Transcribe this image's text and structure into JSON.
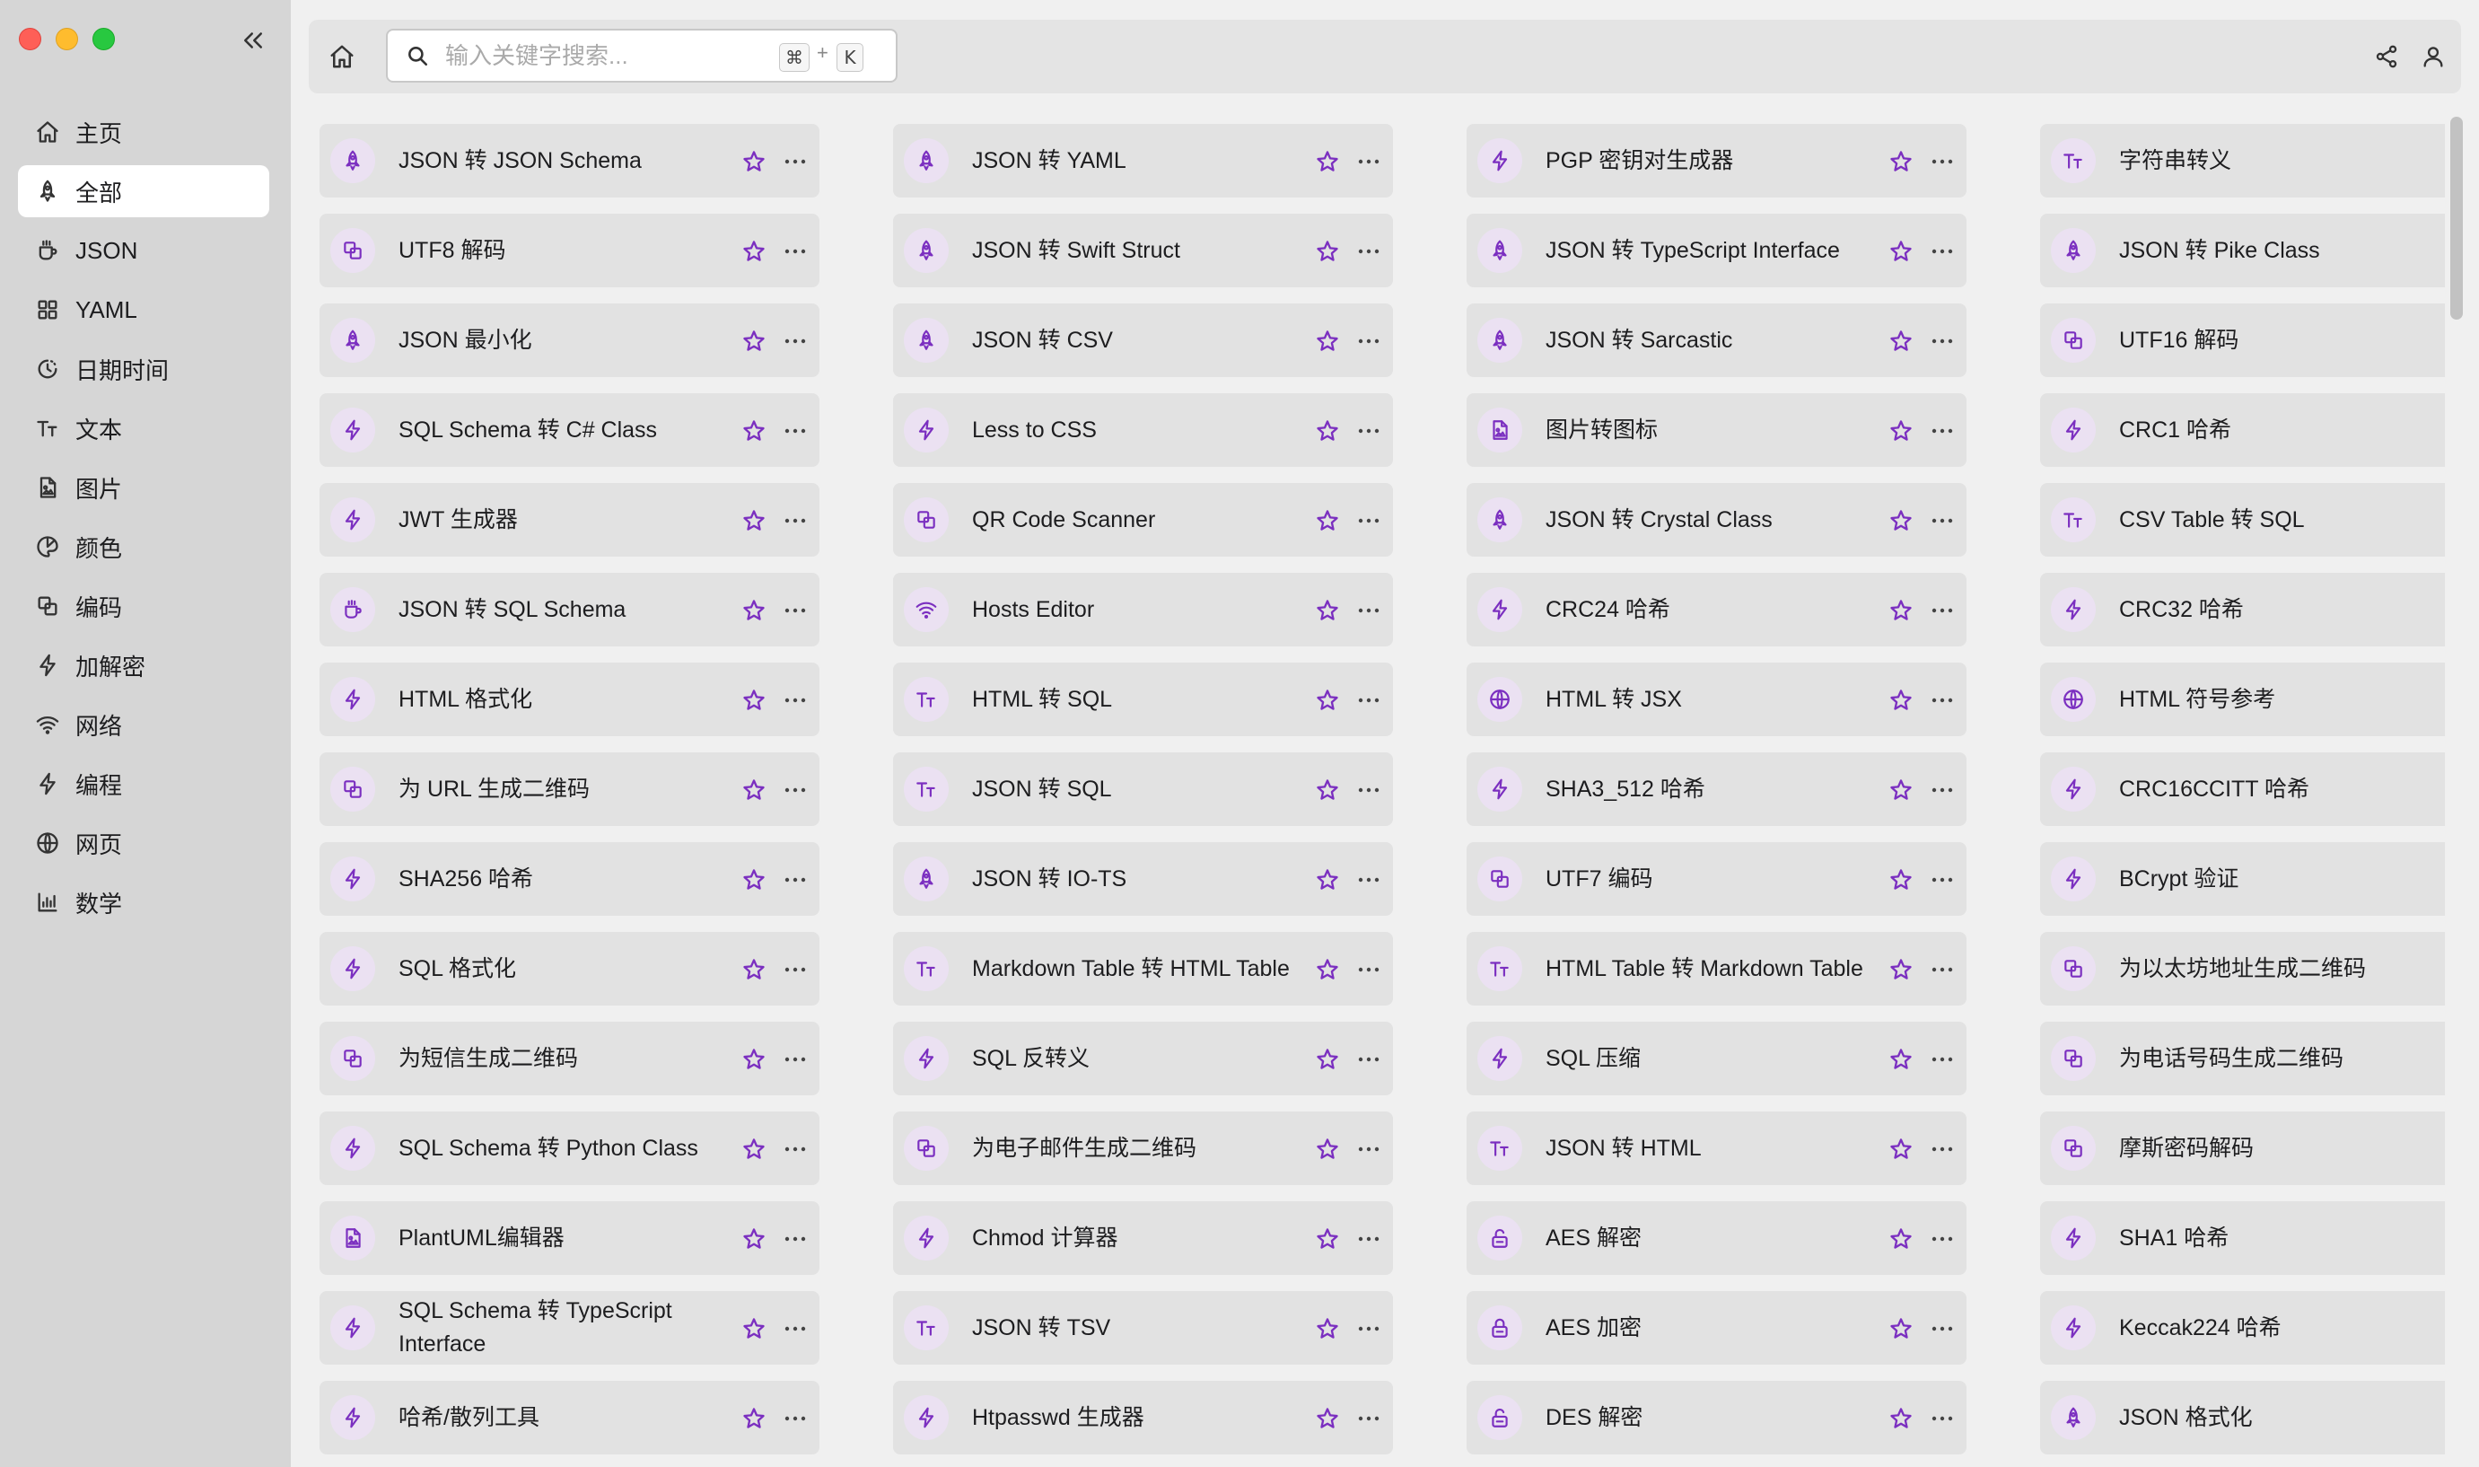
{
  "sidebar": {
    "items": [
      {
        "label": "主页",
        "icon": "home-icon",
        "active": false
      },
      {
        "label": "全部",
        "icon": "rocket-icon",
        "active": true
      },
      {
        "label": "JSON",
        "icon": "mug-icon",
        "active": false
      },
      {
        "label": "YAML",
        "icon": "grid-icon",
        "active": false
      },
      {
        "label": "日期时间",
        "icon": "clock-icon",
        "active": false
      },
      {
        "label": "文本",
        "icon": "text-icon",
        "active": false
      },
      {
        "label": "图片",
        "icon": "file-image-icon",
        "active": false
      },
      {
        "label": "颜色",
        "icon": "palette-icon",
        "active": false
      },
      {
        "label": "编码",
        "icon": "squares-icon",
        "active": false
      },
      {
        "label": "加解密",
        "icon": "bolt-icon",
        "active": false
      },
      {
        "label": "网络",
        "icon": "wifi-icon",
        "active": false
      },
      {
        "label": "编程",
        "icon": "bolt-icon",
        "active": false
      },
      {
        "label": "网页",
        "icon": "globe-icon",
        "active": false
      },
      {
        "label": "数学",
        "icon": "chart-icon",
        "active": false
      }
    ]
  },
  "toolbar": {
    "search_placeholder": "输入关键字搜索...",
    "search_value": "",
    "shortcut_cmd": "⌘",
    "shortcut_plus": "+",
    "shortcut_key": "K"
  },
  "accent_color": "#7b2fc0",
  "tools": [
    [
      {
        "name": "JSON 转 JSON Schema",
        "icon": "rocket-icon"
      },
      {
        "name": "UTF8 解码",
        "icon": "squares-icon"
      },
      {
        "name": "JSON 最小化",
        "icon": "rocket-icon"
      },
      {
        "name": "SQL Schema 转 C# Class",
        "icon": "bolt-icon"
      },
      {
        "name": "JWT 生成器",
        "icon": "bolt-icon"
      },
      {
        "name": "JSON 转 SQL Schema",
        "icon": "mug-icon"
      },
      {
        "name": "HTML 格式化",
        "icon": "bolt-icon"
      },
      {
        "name": "为 URL 生成二维码",
        "icon": "squares-icon"
      },
      {
        "name": "SHA256 哈希",
        "icon": "bolt-icon"
      },
      {
        "name": "SQL 格式化",
        "icon": "bolt-icon"
      },
      {
        "name": "为短信生成二维码",
        "icon": "squares-icon"
      },
      {
        "name": "SQL Schema 转 Python Class",
        "icon": "bolt-icon"
      },
      {
        "name": "PlantUML编辑器",
        "icon": "file-image-icon"
      },
      {
        "name": "SQL Schema 转 TypeScript Interface",
        "icon": "bolt-icon"
      },
      {
        "name": "哈希/散列工具",
        "icon": "bolt-icon"
      }
    ],
    [
      {
        "name": "JSON 转 YAML",
        "icon": "rocket-icon"
      },
      {
        "name": "JSON 转 Swift Struct",
        "icon": "rocket-icon"
      },
      {
        "name": "JSON 转 CSV",
        "icon": "rocket-icon"
      },
      {
        "name": "Less to CSS",
        "icon": "bolt-icon"
      },
      {
        "name": "QR Code Scanner",
        "icon": "squares-icon"
      },
      {
        "name": "Hosts Editor",
        "icon": "wifi-icon"
      },
      {
        "name": "HTML 转 SQL",
        "icon": "text-icon"
      },
      {
        "name": "JSON 转 SQL",
        "icon": "text-icon"
      },
      {
        "name": "JSON 转 IO-TS",
        "icon": "rocket-icon"
      },
      {
        "name": "Markdown Table 转 HTML Table",
        "icon": "text-icon"
      },
      {
        "name": "SQL 反转义",
        "icon": "bolt-icon"
      },
      {
        "name": "为电子邮件生成二维码",
        "icon": "squares-icon"
      },
      {
        "name": "Chmod 计算器",
        "icon": "bolt-icon"
      },
      {
        "name": "JSON 转 TSV",
        "icon": "text-icon"
      },
      {
        "name": "Htpasswd 生成器",
        "icon": "bolt-icon"
      }
    ],
    [
      {
        "name": "PGP 密钥对生成器",
        "icon": "bolt-icon"
      },
      {
        "name": "JSON 转 TypeScript Interface",
        "icon": "rocket-icon"
      },
      {
        "name": "JSON 转 Sarcastic",
        "icon": "rocket-icon"
      },
      {
        "name": "图片转图标",
        "icon": "file-image-icon"
      },
      {
        "name": "JSON 转 Crystal Class",
        "icon": "rocket-icon"
      },
      {
        "name": "CRC24 哈希",
        "icon": "bolt-icon"
      },
      {
        "name": "HTML 转 JSX",
        "icon": "globe-icon"
      },
      {
        "name": "SHA3_512 哈希",
        "icon": "bolt-icon"
      },
      {
        "name": "UTF7 编码",
        "icon": "squares-icon"
      },
      {
        "name": "HTML Table 转 Markdown Table",
        "icon": "text-icon"
      },
      {
        "name": "SQL 压缩",
        "icon": "bolt-icon"
      },
      {
        "name": "JSON 转 HTML",
        "icon": "text-icon"
      },
      {
        "name": "AES 解密",
        "icon": "unlock-icon"
      },
      {
        "name": "AES 加密",
        "icon": "lock-icon"
      },
      {
        "name": "DES 解密",
        "icon": "unlock-icon"
      }
    ],
    [
      {
        "name": "字符串转义",
        "icon": "text-icon"
      },
      {
        "name": "JSON 转 Pike Class",
        "icon": "rocket-icon"
      },
      {
        "name": "UTF16 解码",
        "icon": "squares-icon"
      },
      {
        "name": "CRC1 哈希",
        "icon": "bolt-icon"
      },
      {
        "name": "CSV Table 转 SQL",
        "icon": "text-icon"
      },
      {
        "name": "CRC32 哈希",
        "icon": "bolt-icon"
      },
      {
        "name": "HTML 符号参考",
        "icon": "globe-icon"
      },
      {
        "name": "CRC16CCITT 哈希",
        "icon": "bolt-icon"
      },
      {
        "name": "BCrypt 验证",
        "icon": "bolt-icon"
      },
      {
        "name": "为以太坊地址生成二维码",
        "icon": "squares-icon"
      },
      {
        "name": "为电话号码生成二维码",
        "icon": "squares-icon"
      },
      {
        "name": "摩斯密码解码",
        "icon": "squares-icon"
      },
      {
        "name": "SHA1 哈希",
        "icon": "bolt-icon"
      },
      {
        "name": "Keccak224 哈希",
        "icon": "bolt-icon"
      },
      {
        "name": "JSON 格式化",
        "icon": "rocket-icon"
      }
    ]
  ]
}
